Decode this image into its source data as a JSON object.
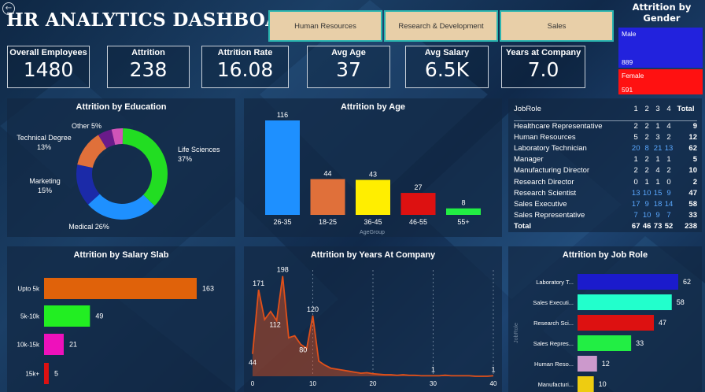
{
  "title": "HR ANALYTICS DASHBOARD",
  "slicers": [
    "Human Resources",
    "Research & Development",
    "Sales"
  ],
  "gender": {
    "title_line1": "Attrition by",
    "title_line2": "Gender",
    "male_label": "Male",
    "male_value": "889",
    "female_label": "Female",
    "female_value": "591",
    "male_color": "#2222dd",
    "female_color": "#ff1111"
  },
  "kpis": [
    {
      "label": "Overall Employees",
      "value": "1480"
    },
    {
      "label": "Attrition",
      "value": "238"
    },
    {
      "label": "Attrition Rate",
      "value": "16.08"
    },
    {
      "label": "Avg Age",
      "value": "37"
    },
    {
      "label": "Avg Salary",
      "value": "6.5K"
    },
    {
      "label": "Years at Company",
      "value": "7.0"
    }
  ],
  "panels": {
    "education": "Attrition by Education",
    "age": "Attrition by Age",
    "salary": "Attrition by Salary Slab",
    "years": "Attrition by Years At Company",
    "jobrole": "Attrition by Job Role"
  },
  "chart_data": [
    {
      "type": "pie",
      "title": "Attrition by Education",
      "donut": true,
      "categories": [
        "Life Sciences",
        "Medical",
        "Marketing",
        "Technical Degree",
        "Other"
      ],
      "values": [
        37,
        26,
        15,
        13,
        5
      ],
      "extra_slice": {
        "value": 4,
        "color": "#d154b8"
      },
      "labels": [
        "Life Sciences\n37%",
        "Medical 26%",
        "Marketing\n15%",
        "Technical Degree\n13%",
        "Other 5%"
      ],
      "colors": [
        "#22dd22",
        "#1e90ff",
        "#1b2aa8",
        "#e0703a",
        "#6a1b8a"
      ]
    },
    {
      "type": "bar",
      "title": "Attrition by Age",
      "categories": [
        "26-35",
        "18-25",
        "36-45",
        "46-55",
        "55+"
      ],
      "values": [
        116,
        44,
        43,
        27,
        8
      ],
      "colors": [
        "#1e90ff",
        "#e0703a",
        "#ffee00",
        "#dd1111",
        "#22ee44"
      ],
      "xlabel": "AgeGroup",
      "ylim": [
        0,
        116
      ]
    },
    {
      "type": "table",
      "columns": [
        "JobRole",
        "1",
        "2",
        "3",
        "4",
        "Total"
      ],
      "rows": [
        [
          "Healthcare Representative",
          "2",
          "2",
          "1",
          "4",
          "9"
        ],
        [
          "Human Resources",
          "5",
          "2",
          "3",
          "2",
          "12"
        ],
        [
          "Laboratory Technician",
          "20",
          "8",
          "21",
          "13",
          "62"
        ],
        [
          "Manager",
          "1",
          "2",
          "1",
          "1",
          "5"
        ],
        [
          "Manufacturing Director",
          "2",
          "2",
          "4",
          "2",
          "10"
        ],
        [
          "Research Director",
          "0",
          "1",
          "1",
          "0",
          "2"
        ],
        [
          "Research Scientist",
          "13",
          "10",
          "15",
          "9",
          "47"
        ],
        [
          "Sales Executive",
          "17",
          "9",
          "18",
          "14",
          "58"
        ],
        [
          "Sales Representative",
          "7",
          "10",
          "9",
          "7",
          "33"
        ]
      ],
      "total_row": [
        "Total",
        "67",
        "46",
        "73",
        "52",
        "238"
      ],
      "highlight_color": "#5aa8ff"
    },
    {
      "type": "bar",
      "orientation": "horizontal",
      "title": "Attrition by Salary Slab",
      "categories": [
        "Upto 5k",
        "5k-10k",
        "10k-15k",
        "15k+"
      ],
      "values": [
        163,
        49,
        21,
        5
      ],
      "colors": [
        "#e0620a",
        "#22ee22",
        "#ee11bb",
        "#dd1111"
      ]
    },
    {
      "type": "area",
      "title": "Attrition by Years At Company",
      "x": [
        0,
        1,
        2,
        3,
        4,
        5,
        6,
        7,
        8,
        9,
        10,
        11,
        12,
        13,
        14,
        15,
        16,
        17,
        18,
        19,
        20,
        21,
        22,
        23,
        24,
        25,
        26,
        27,
        28,
        29,
        30,
        31,
        32,
        33,
        34,
        35,
        36,
        37,
        38,
        39,
        40
      ],
      "y": [
        44,
        171,
        112,
        128,
        110,
        198,
        76,
        80,
        63,
        55,
        120,
        30,
        22,
        16,
        14,
        12,
        10,
        8,
        6,
        7,
        5,
        4,
        3,
        3,
        2,
        3,
        2,
        2,
        1,
        1,
        1,
        1,
        2,
        1,
        1,
        1,
        1,
        0,
        0,
        0,
        1
      ],
      "point_labels": [
        {
          "x": 0,
          "label": "44"
        },
        {
          "x": 1,
          "label": "171"
        },
        {
          "x": 5,
          "label": "198"
        },
        {
          "x": 4,
          "label": "112"
        },
        {
          "x": 10,
          "label": "120"
        },
        {
          "x": 8,
          "label": "80"
        },
        {
          "x": 30,
          "label": "1"
        },
        {
          "x": 40,
          "label": "1"
        }
      ],
      "xticks": [
        "0",
        "10",
        "20",
        "30",
        "40"
      ],
      "xlim": [
        0,
        40
      ],
      "ylim": [
        0,
        210
      ],
      "color": "#e0501a"
    },
    {
      "type": "bar",
      "orientation": "horizontal",
      "title": "Attrition by Job Role",
      "categories": [
        "Laboratory T...",
        "Sales Executi...",
        "Research Sci...",
        "Sales Repres...",
        "Human Reso...",
        "Manufacturi..."
      ],
      "values": [
        62,
        58,
        47,
        33,
        12,
        10
      ],
      "colors": [
        "#1b1bcc",
        "#22ffcc",
        "#dd1111",
        "#22ee44",
        "#cc99cc",
        "#eecc11"
      ],
      "ylabel": "JobRole"
    }
  ]
}
